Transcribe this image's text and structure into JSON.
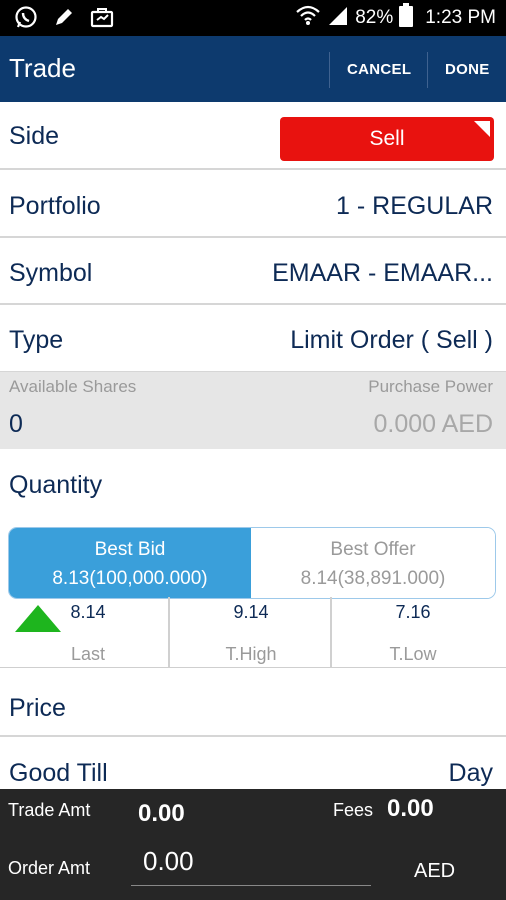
{
  "status_bar": {
    "battery": "82%",
    "time": "1:23 PM",
    "icons": [
      "whatsapp-icon",
      "pencil-icon",
      "briefcase-icon",
      "wifi-icon",
      "signal-icon",
      "battery-icon"
    ]
  },
  "app_bar": {
    "title": "Trade",
    "cancel_label": "CANCEL",
    "done_label": "DONE"
  },
  "form": {
    "side": {
      "label": "Side",
      "value": "Sell"
    },
    "portfolio": {
      "label": "Portfolio",
      "value": "1 - REGULAR"
    },
    "symbol": {
      "label": "Symbol",
      "value": "EMAAR - EMAAR..."
    },
    "type": {
      "label": "Type",
      "value": "Limit Order ( Sell )"
    },
    "available_shares": {
      "label": "Available Shares",
      "value": "0"
    },
    "purchase_power": {
      "label": "Purchase Power",
      "value": "0.000 AED"
    },
    "quantity": {
      "label": "Quantity"
    },
    "price": {
      "label": "Price"
    },
    "good_till": {
      "label": "Good Till",
      "value": "Day"
    }
  },
  "market": {
    "best_bid": {
      "label": "Best Bid",
      "value": "8.13(100,000.000)"
    },
    "best_offer": {
      "label": "Best Offer",
      "value": "8.14(38,891.000)"
    },
    "last": {
      "label": "Last",
      "value": "8.14"
    },
    "t_high": {
      "label": "T.High",
      "value": "9.14"
    },
    "t_low": {
      "label": "T.Low",
      "value": "7.16"
    }
  },
  "summary": {
    "trade_amt_label": "Trade Amt",
    "trade_amt_value": "0.00",
    "fees_label": "Fees",
    "fees_value": "0.00",
    "order_amt_label": "Order Amt",
    "order_amt_value": "0.00",
    "currency": "AED"
  },
  "colors": {
    "app_bar": "#0d3a6e",
    "sell": "#e8120f",
    "bid": "#3a9fda",
    "up_arrow": "#1eb51e",
    "footer": "#262626"
  }
}
